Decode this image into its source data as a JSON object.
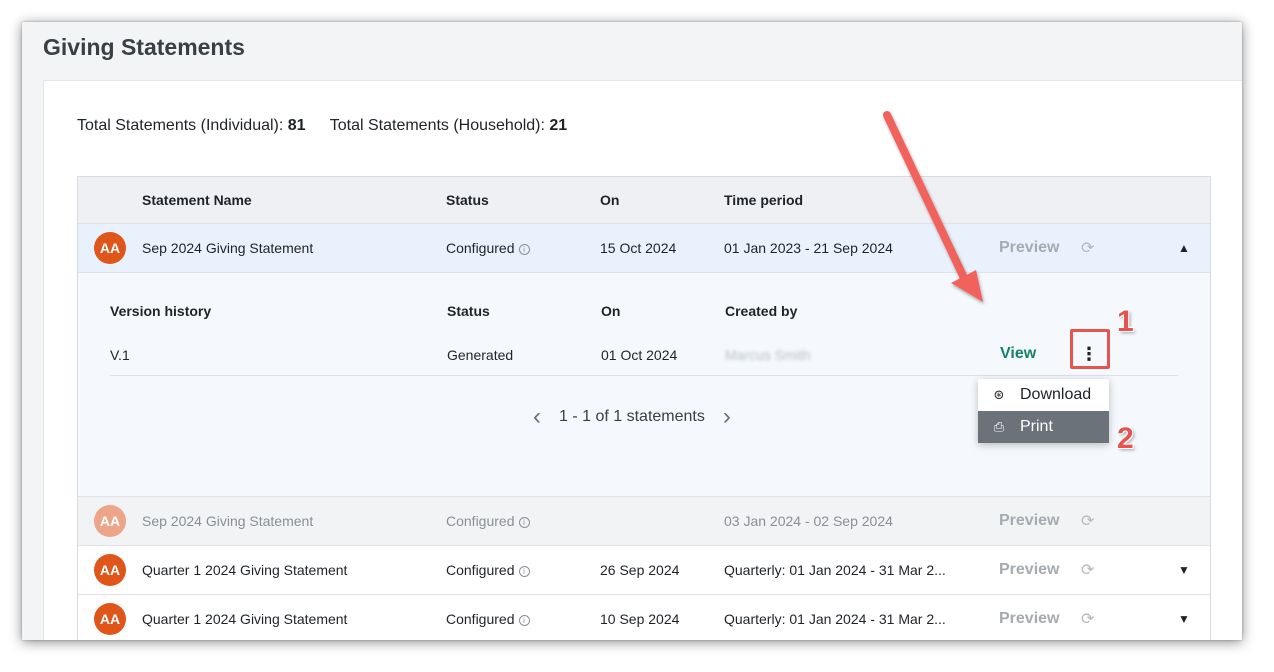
{
  "page": {
    "title": "Giving Statements"
  },
  "totals": {
    "individual_label": "Total Statements (Individual):",
    "individual_value": "81",
    "household_label": "Total Statements (Household):",
    "household_value": "21"
  },
  "table": {
    "headers": {
      "name": "Statement Name",
      "status": "Status",
      "on": "On",
      "period": "Time period"
    },
    "rows": [
      {
        "avatar": "AA",
        "name": "Sep 2024 Giving Statement",
        "status": "Configured",
        "on": "15 Oct 2024",
        "period": "01 Jan 2023 - 21 Sep 2024",
        "preview": "Preview",
        "state": "expanded"
      },
      {
        "avatar": "AA",
        "name": "Sep 2024 Giving Statement",
        "status": "Configured",
        "on": "",
        "period": "03 Jan 2024 - 02 Sep 2024",
        "preview": "Preview",
        "state": "faded"
      },
      {
        "avatar": "AA",
        "name": "Quarter 1 2024 Giving Statement",
        "status": "Configured",
        "on": "26 Sep 2024",
        "period": "Quarterly: 01 Jan 2024 - 31 Mar 2...",
        "preview": "Preview",
        "state": "collapsed"
      },
      {
        "avatar": "AA",
        "name": "Quarter 1 2024 Giving Statement",
        "status": "Configured",
        "on": "10 Sep 2024",
        "period": "Quarterly: 01 Jan 2024 - 31 Mar 2...",
        "preview": "Preview",
        "state": "collapsed"
      }
    ]
  },
  "version_history": {
    "headers": {
      "version": "Version history",
      "status": "Status",
      "on": "On",
      "created_by": "Created by"
    },
    "rows": [
      {
        "version": "V.1",
        "status": "Generated",
        "on": "01 Oct 2024",
        "created_by": "Marcus Smith",
        "view": "View"
      }
    ],
    "pagination": "1 - 1 of 1 statements"
  },
  "action_menu": {
    "items": [
      {
        "label": "Download",
        "icon": "download-icon"
      },
      {
        "label": "Print",
        "icon": "printer-icon",
        "highlighted": true
      }
    ]
  },
  "annotations": {
    "step1": "1",
    "step2": "2",
    "color": "#e8534f"
  },
  "colors": {
    "avatar": "#e0561a",
    "view_link": "#16806e",
    "active_row": "#e9f2fc",
    "menu_highlight": "#6c727a"
  }
}
